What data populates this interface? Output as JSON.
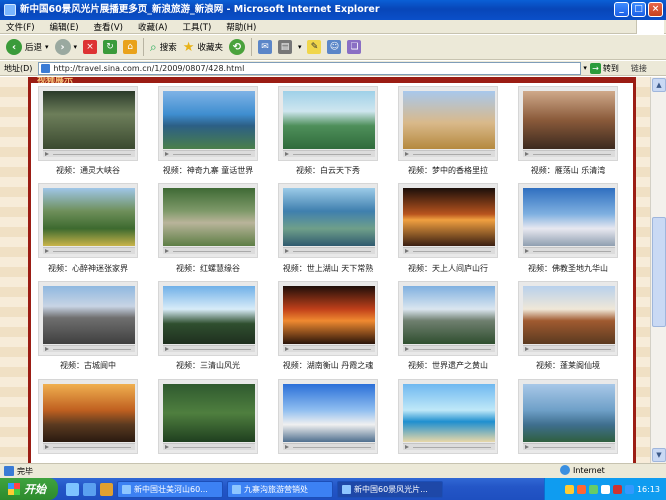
{
  "window": {
    "title": "新中国60景风光片展播更多页_新浪旅游_新浪网 - Microsoft Internet Explorer"
  },
  "menu": [
    "文件(F)",
    "编辑(E)",
    "查看(V)",
    "收藏(A)",
    "工具(T)",
    "帮助(H)"
  ],
  "toolbar": {
    "back": "后退",
    "search": "搜索",
    "favorites": "收藏夹"
  },
  "address": {
    "label": "地址(D)",
    "url": "http://travel.sina.com.cn/1/2009/0807/428.html",
    "go": "转到",
    "links": "链接"
  },
  "page": {
    "section_title": "视频展示"
  },
  "videos": [
    {
      "caption": "视频：通灵大峡谷"
    },
    {
      "caption": "视频：神奇九寨 童话世界"
    },
    {
      "caption": "视频：白云天下秀"
    },
    {
      "caption": "视频：梦中的香格里拉"
    },
    {
      "caption": "视频：雁荡山 乐清湾"
    },
    {
      "caption": "视频：心醉神迷张家界"
    },
    {
      "caption": "视频：红螺慧缘谷"
    },
    {
      "caption": "视频：世上湖山 天下常熟"
    },
    {
      "caption": "视频：天上人间庐山行"
    },
    {
      "caption": "视频：佛教圣地九华山"
    },
    {
      "caption": "视频：古城阆中"
    },
    {
      "caption": "视频：三清山风光"
    },
    {
      "caption": "视频：湖南衡山 丹霞之魂"
    },
    {
      "caption": "视频：世界遗产之黄山"
    },
    {
      "caption": "视频：蓬莱阁仙境"
    },
    {
      "caption": ""
    },
    {
      "caption": ""
    },
    {
      "caption": ""
    },
    {
      "caption": ""
    },
    {
      "caption": ""
    }
  ],
  "status": {
    "text": "完毕",
    "zone": "Internet"
  },
  "taskbar": {
    "start": "开始",
    "tasks": [
      "新中国壮美河山60...",
      "九寨沟旅游营销处",
      "新中国60景风光片..."
    ],
    "clock": "16:13"
  }
}
